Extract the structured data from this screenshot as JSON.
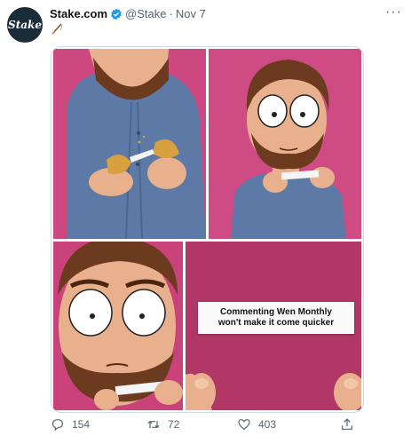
{
  "tweet": {
    "avatar_text": "Stake",
    "display_name": "Stake.com",
    "handle": "@Stake",
    "separator": "·",
    "date": "Nov 7",
    "more": "···",
    "emoji_icon": "fishing-pole-icon"
  },
  "comic": {
    "note_line1": "Commenting Wen Monthly",
    "note_line2": "won't make it come quicker",
    "background_color": "#c9427a"
  },
  "actions": {
    "reply_count": "154",
    "retweet_count": "72",
    "like_count": "403"
  },
  "colors": {
    "verified": "#1d9bf0",
    "muted_text": "#536471"
  }
}
